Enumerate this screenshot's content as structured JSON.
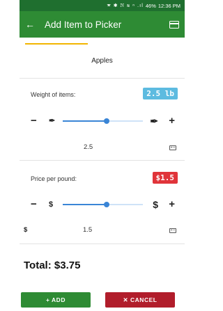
{
  "status_bar": {
    "icons": "🕿 ✱ ℕ ≋ ⁿ .ıl",
    "battery": "46%",
    "time": "12:36 PM"
  },
  "app_bar": {
    "back_icon": "←",
    "title": "Add Item to Picker",
    "action_icon": "menu-icon"
  },
  "product": {
    "name": "Apples"
  },
  "weight": {
    "label": "Weight of items:",
    "badge": "2.5 lb",
    "minus": "−",
    "plus": "+",
    "left_icon": "✒",
    "right_icon": "✒",
    "level_fraction": 0.55,
    "value": "2.5"
  },
  "price": {
    "label": "Price per pound:",
    "badge": "$1.5",
    "minus": "−",
    "plus": "+",
    "left_icon": "$",
    "right_icon": "$",
    "currency_symbol": "$",
    "level_fraction": 0.55,
    "value": "1.5"
  },
  "total": "Total: $3.75",
  "buttons": {
    "add": "+ ADD",
    "cancel": "✕ CANCEL"
  },
  "colors": {
    "primary": "#2e8b34",
    "status": "#1f6f2f",
    "accent": "#f2b500",
    "slider": "#3a85d6",
    "weight_badge": "#5dbbe0",
    "price_badge": "#e0343a",
    "cancel": "#b11d2b"
  }
}
